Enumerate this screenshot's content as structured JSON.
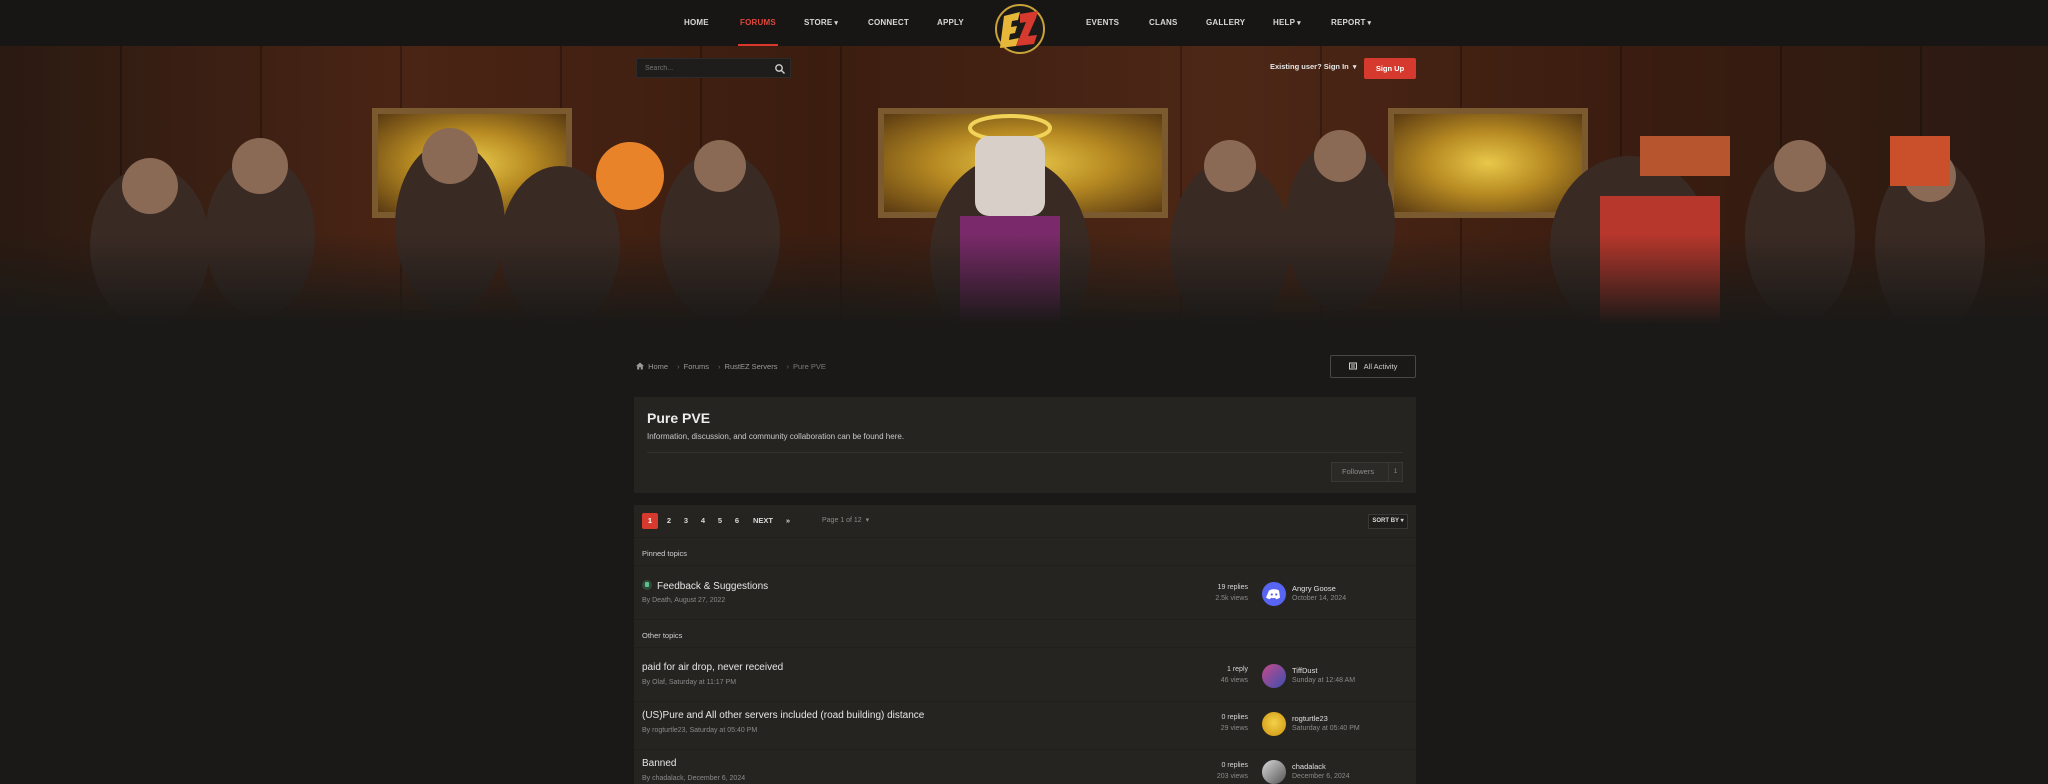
{
  "nav": {
    "left_items": [
      {
        "label": "HOME"
      },
      {
        "label": "FORUMS"
      },
      {
        "label": "STORE"
      },
      {
        "label": "CONNECT"
      },
      {
        "label": "APPLY"
      }
    ],
    "right_items": [
      {
        "label": "EVENTS"
      },
      {
        "label": "CLANS"
      },
      {
        "label": "GALLERY"
      },
      {
        "label": "HELP"
      },
      {
        "label": "REPORT"
      }
    ],
    "active": "FORUMS",
    "logo_text": "EZ"
  },
  "search": {
    "placeholder": "Search..."
  },
  "auth": {
    "signin_label": "Existing user? Sign In",
    "signup_label": "Sign Up"
  },
  "breadcrumb": [
    "Home",
    "Forums",
    "RustEZ Servers",
    "Pure PVE"
  ],
  "all_activity_label": "All Activity",
  "forum": {
    "title": "Pure PVE",
    "description": "Information, discussion, and community collaboration can be found here.",
    "followers_label": "Followers",
    "followers_count": "1"
  },
  "pagination": {
    "pages": [
      "1",
      "2",
      "3",
      "4",
      "5",
      "6"
    ],
    "current": "1",
    "next_label": "NEXT",
    "last_label": "»",
    "page_of": "Page 1 of 12",
    "sort_label": "SORT BY"
  },
  "pinned_label": "Pinned topics",
  "other_label": "Other topics",
  "pinned_topics": [
    {
      "title": "Feedback & Suggestions",
      "meta": "By Death, August 27, 2022",
      "replies": "19 replies",
      "views": "2.5k views",
      "last_user": "Angry Goose",
      "last_time": "October 14, 2024"
    }
  ],
  "topics": [
    {
      "title": "paid for air drop, never received",
      "meta": "By Olaf, Saturday at 11:17 PM",
      "replies": "1 reply",
      "views": "46 views",
      "last_user": "TiffDust",
      "last_time": "Sunday at 12:48 AM"
    },
    {
      "title": "(US)Pure and All other servers included (road building) distance",
      "meta": "By rogturtle23, Saturday at 05:40 PM",
      "replies": "0 replies",
      "views": "29 views",
      "last_user": "rogturtle23",
      "last_time": "Saturday at 05:40 PM"
    },
    {
      "title": "Banned",
      "meta": "By chadalack, December 6, 2024",
      "replies": "0 replies",
      "views": "203 views",
      "last_user": "chadalack",
      "last_time": "December 6, 2024"
    }
  ],
  "colors": {
    "accent": "#d63a2e",
    "background": "#1a1917",
    "panel": "#262421"
  }
}
